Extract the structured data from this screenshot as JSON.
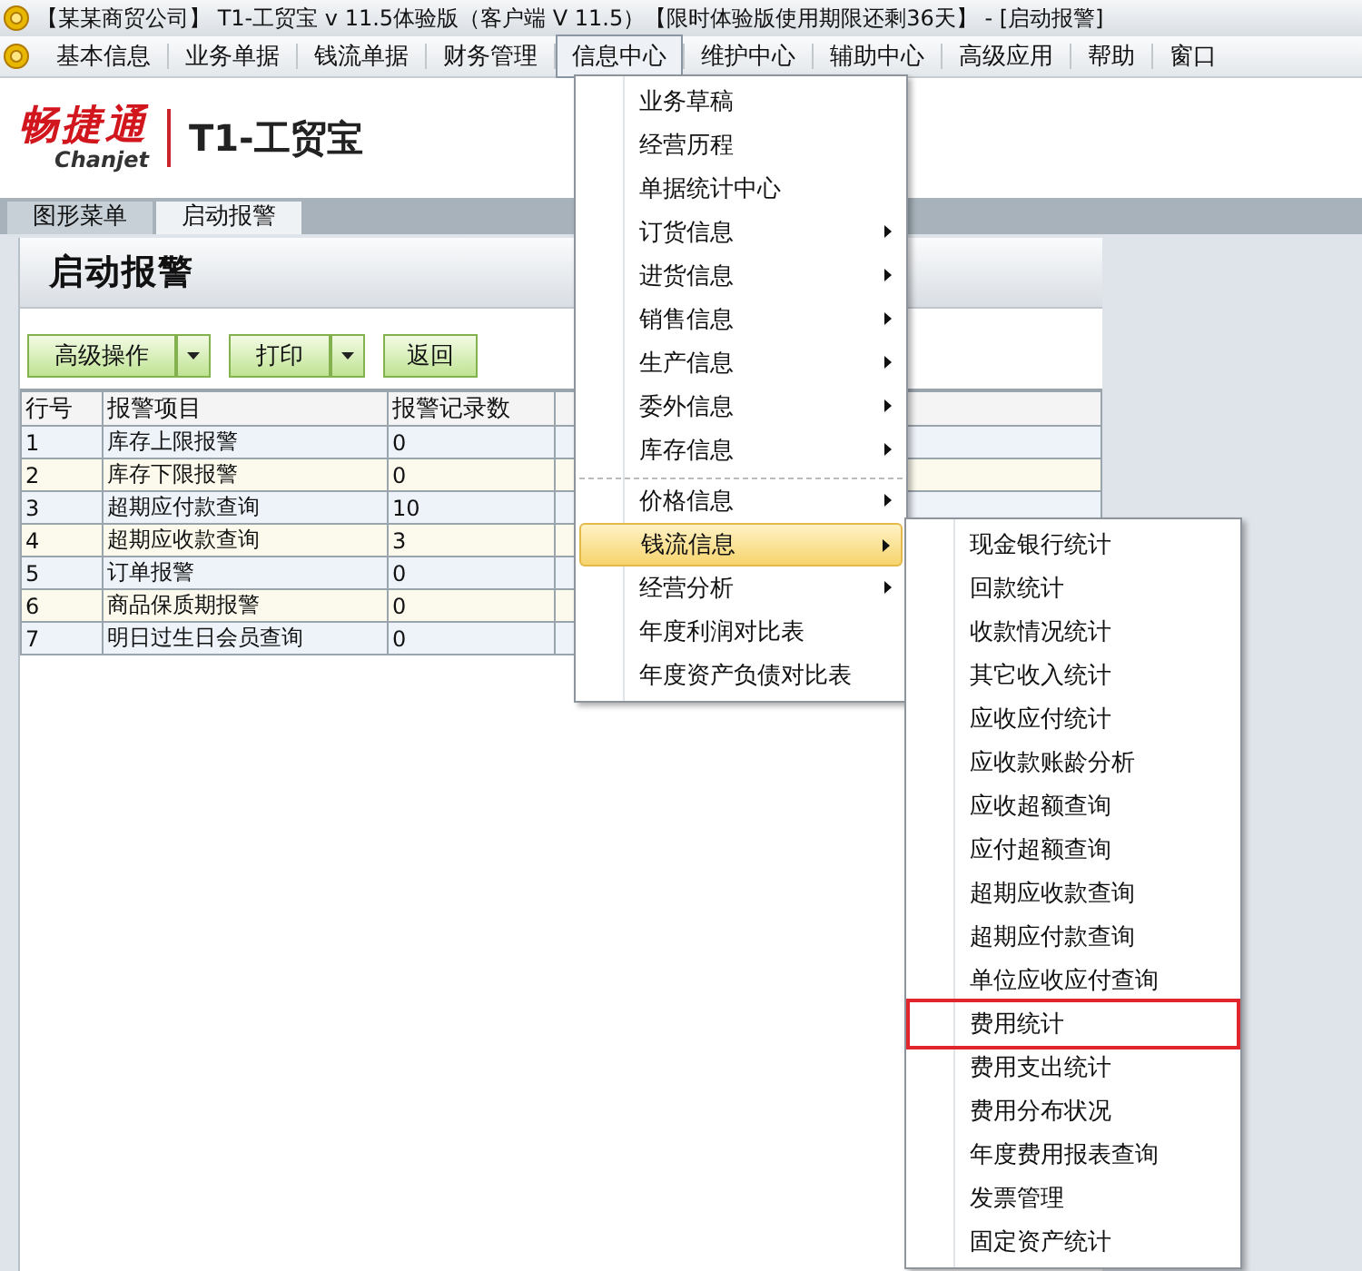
{
  "window": {
    "title": "【某某商贸公司】 T1-工贸宝 v 11.5体验版（客户端 V 11.5）【限时体验版使用期限还剩36天】 - [启动报警]"
  },
  "menubar": [
    {
      "label": "基本信息",
      "selected": false
    },
    {
      "label": "业务单据",
      "selected": false
    },
    {
      "label": "钱流单据",
      "selected": false
    },
    {
      "label": "财务管理",
      "selected": false
    },
    {
      "label": "信息中心",
      "selected": true
    },
    {
      "label": "维护中心",
      "selected": false
    },
    {
      "label": "辅助中心",
      "selected": false
    },
    {
      "label": "高级应用",
      "selected": false
    },
    {
      "label": "帮助",
      "selected": false
    },
    {
      "label": "窗口",
      "selected": false
    }
  ],
  "logo": {
    "brand": "畅捷通",
    "brand_latin": "Chanjet",
    "product": "T1-工贸宝"
  },
  "tabs": [
    {
      "label": "图形菜单",
      "selected": false
    },
    {
      "label": "启动报警",
      "selected": true
    }
  ],
  "page": {
    "title": "启动报警",
    "toolbar": [
      {
        "label": "高级操作",
        "kind": "split"
      },
      {
        "label": "打印",
        "kind": "split"
      },
      {
        "label": "返回",
        "kind": "plain"
      }
    ],
    "table": {
      "columns": [
        "行号",
        "报警项目",
        "报警记录数"
      ],
      "rows": [
        [
          "1",
          "库存上限报警",
          "0"
        ],
        [
          "2",
          "库存下限报警",
          "0"
        ],
        [
          "3",
          "超期应付款查询",
          "10"
        ],
        [
          "4",
          "超期应收款查询",
          "3"
        ],
        [
          "5",
          "订单报警",
          "0"
        ],
        [
          "6",
          "商品保质期报警",
          "0"
        ],
        [
          "7",
          "明日过生日会员查询",
          "0"
        ]
      ]
    }
  },
  "menu": {
    "items": [
      {
        "label": "业务草稿",
        "has_submenu": false,
        "selected": false,
        "separator_before": false
      },
      {
        "label": "经营历程",
        "has_submenu": false,
        "selected": false,
        "separator_before": false
      },
      {
        "label": "单据统计中心",
        "has_submenu": false,
        "selected": false,
        "separator_before": false
      },
      {
        "label": "订货信息",
        "has_submenu": true,
        "selected": false,
        "separator_before": false
      },
      {
        "label": "进货信息",
        "has_submenu": true,
        "selected": false,
        "separator_before": false
      },
      {
        "label": "销售信息",
        "has_submenu": true,
        "selected": false,
        "separator_before": false
      },
      {
        "label": "生产信息",
        "has_submenu": true,
        "selected": false,
        "separator_before": false
      },
      {
        "label": "委外信息",
        "has_submenu": true,
        "selected": false,
        "separator_before": false
      },
      {
        "label": "库存信息",
        "has_submenu": true,
        "selected": false,
        "separator_before": false
      },
      {
        "label": "价格信息",
        "has_submenu": true,
        "selected": false,
        "separator_before": true
      },
      {
        "label": "钱流信息",
        "has_submenu": true,
        "selected": true,
        "separator_before": false
      },
      {
        "label": "经营分析",
        "has_submenu": true,
        "selected": false,
        "separator_before": false
      },
      {
        "label": "年度利润对比表",
        "has_submenu": false,
        "selected": false,
        "separator_before": false
      },
      {
        "label": "年度资产负债对比表",
        "has_submenu": false,
        "selected": false,
        "separator_before": false
      }
    ]
  },
  "submenu": {
    "items": [
      {
        "label": "现金银行统计",
        "highlighted": false
      },
      {
        "label": "回款统计",
        "highlighted": false
      },
      {
        "label": "收款情况统计",
        "highlighted": false
      },
      {
        "label": "其它收入统计",
        "highlighted": false
      },
      {
        "label": "应收应付统计",
        "highlighted": false
      },
      {
        "label": "应收款账龄分析",
        "highlighted": false
      },
      {
        "label": "应收超额查询",
        "highlighted": false
      },
      {
        "label": "应付超额查询",
        "highlighted": false
      },
      {
        "label": "超期应收款查询",
        "highlighted": false
      },
      {
        "label": "超期应付款查询",
        "highlighted": false
      },
      {
        "label": "单位应收应付查询",
        "highlighted": false
      },
      {
        "label": "费用统计",
        "highlighted": true
      },
      {
        "label": "费用支出统计",
        "highlighted": false
      },
      {
        "label": "费用分布状况",
        "highlighted": false
      },
      {
        "label": "年度费用报表查询",
        "highlighted": false
      },
      {
        "label": "发票管理",
        "highlighted": false
      },
      {
        "label": "固定资产统计",
        "highlighted": false
      }
    ]
  }
}
